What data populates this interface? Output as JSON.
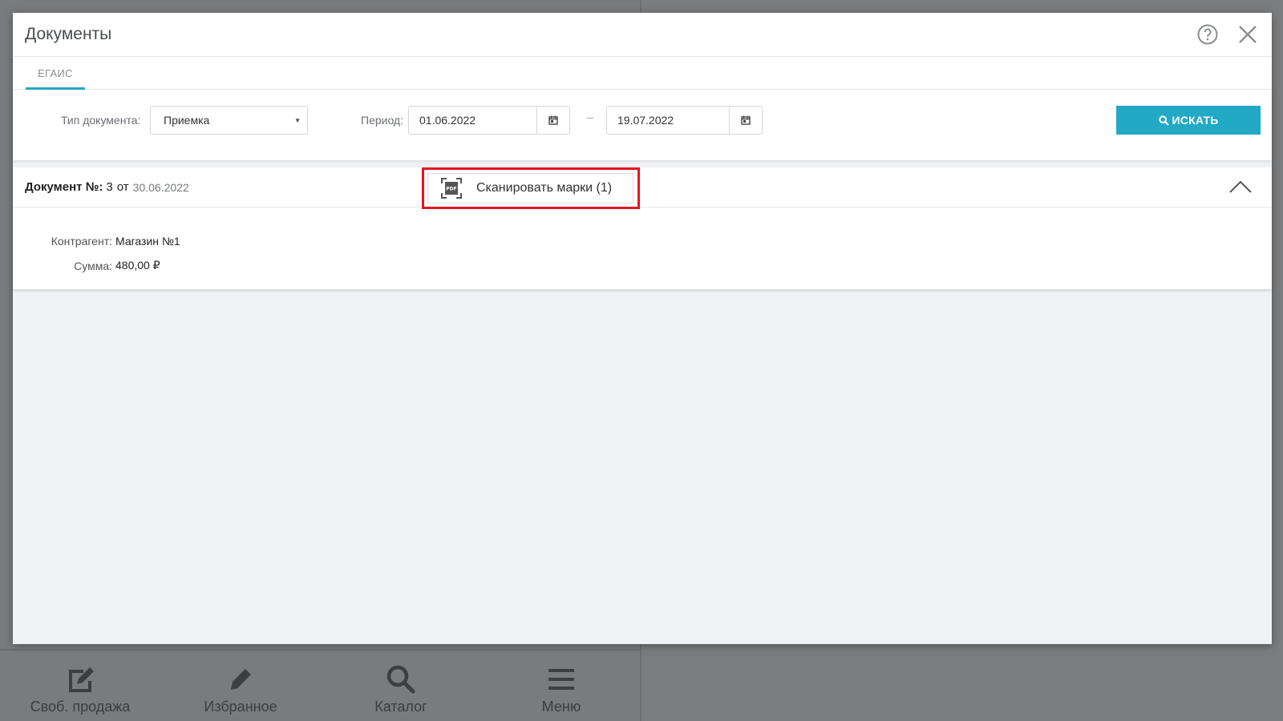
{
  "modal": {
    "title": "Документы",
    "tabs": [
      {
        "label": "ЕГАИС",
        "active": true
      }
    ],
    "filters": {
      "doc_type_label": "Тип документа:",
      "doc_type_value": "Приемка",
      "period_label": "Период:",
      "date_from": "01.06.2022",
      "date_separator": "–",
      "date_to": "19.07.2022",
      "search_label": "ИСКАТЬ"
    },
    "document": {
      "title_label": "Документ №:",
      "number": "3",
      "from_word": "от",
      "date": "30.06.2022",
      "scan_button_label": "Сканировать марки (1)",
      "counterparty_label": "Контрагент:",
      "counterparty_value": "Магазин №1",
      "sum_label": "Сумма:",
      "sum_value": "480,00 ₽"
    }
  },
  "bottom_nav": [
    {
      "label": "Своб. продажа",
      "icon": "edit-note-icon"
    },
    {
      "label": "Избранное",
      "icon": "pencil-icon"
    },
    {
      "label": "Каталог",
      "icon": "search-icon"
    },
    {
      "label": "Меню",
      "icon": "menu-icon"
    }
  ],
  "colors": {
    "accent": "#21a9c6",
    "highlight": "#e3161f",
    "overlay": "#7b7c7e"
  }
}
